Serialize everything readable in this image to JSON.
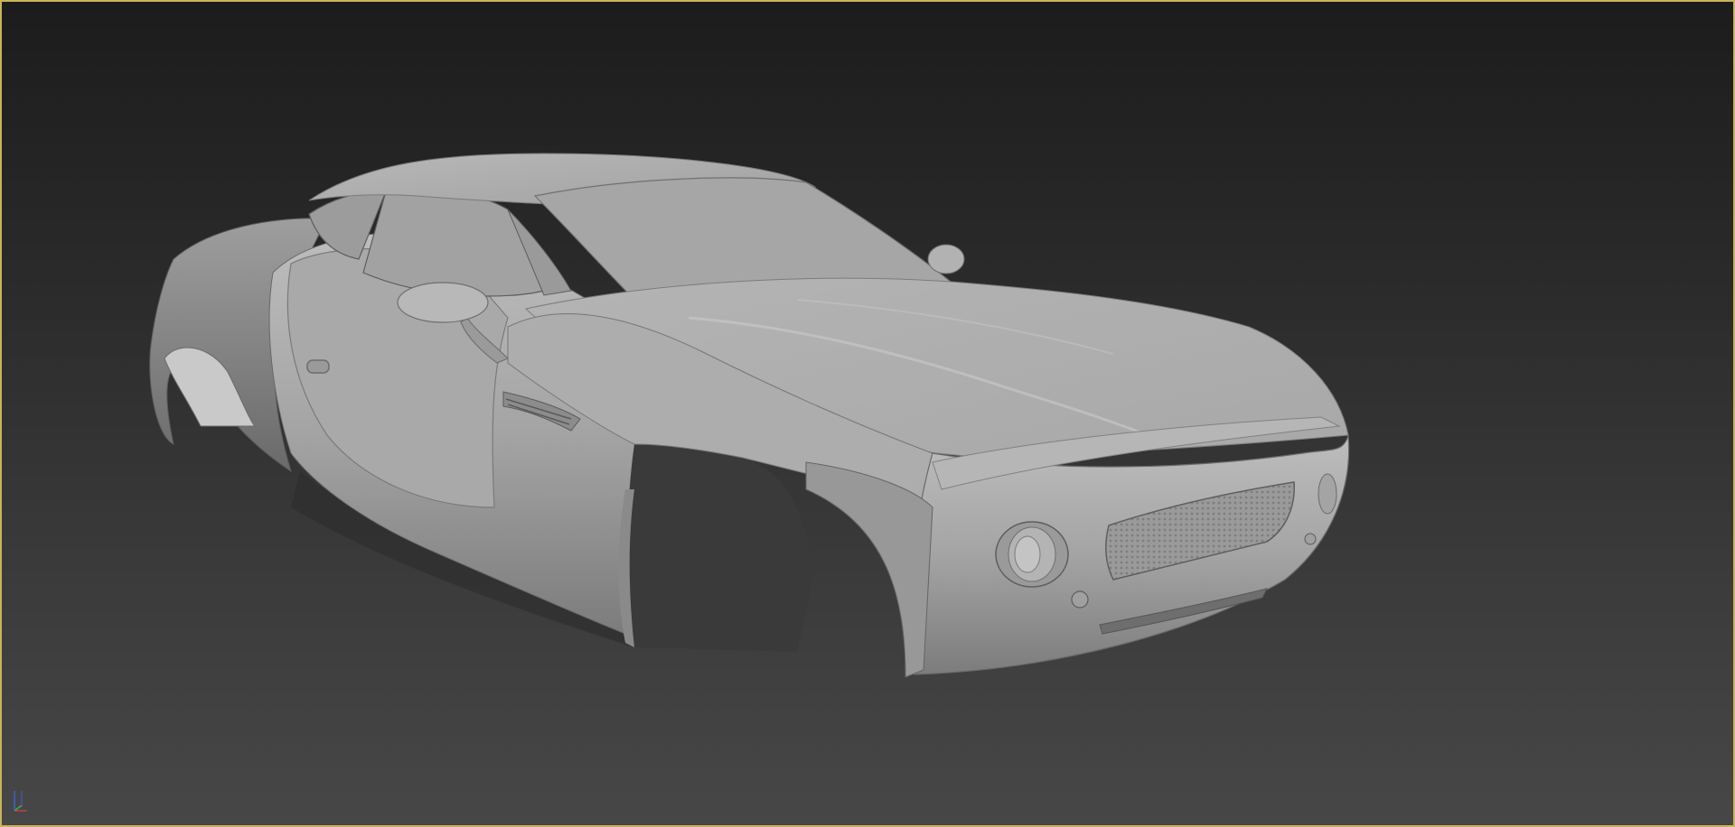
{
  "viewport": {
    "label": "",
    "border_color": "#c8b45a",
    "background_top": "#1c1c1c",
    "background_bottom": "#474747"
  },
  "model": {
    "shading": "clay-grey",
    "body_color": "#a6a6a6",
    "highlight_color": "#c2c2c2",
    "shadow_color": "#6e6e6e"
  },
  "gizmo": {
    "icon": "axis-tripod-icon",
    "x_color": "#c04040",
    "y_color": "#40b040",
    "z_color": "#4060d0"
  }
}
